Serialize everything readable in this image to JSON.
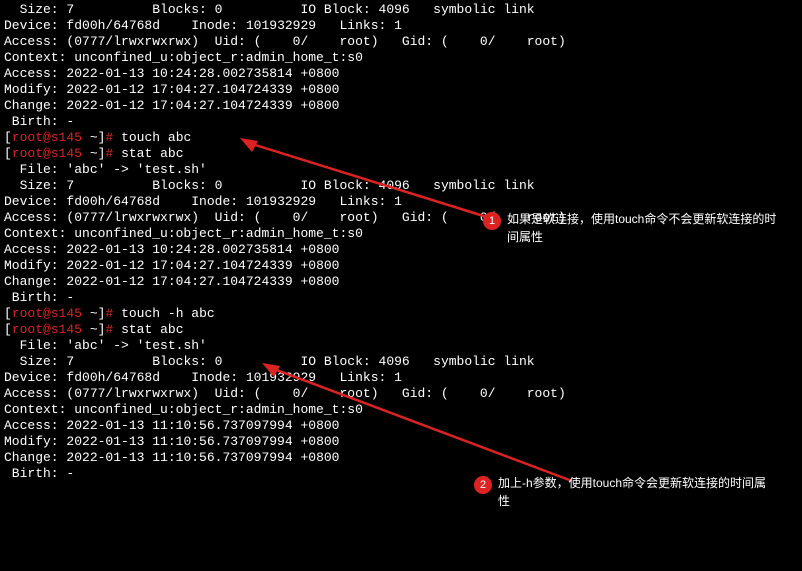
{
  "stat1": {
    "size_label": "  Size: ",
    "size_val": "7",
    "blocks_label": "          Blocks: ",
    "blocks_val": "0",
    "ioblock_label": "          IO Block: ",
    "ioblock_val": "4096",
    "type": "   symbolic link",
    "device_label": "Device: ",
    "device_val": "fd00h/64768d",
    "inode_label": "    Inode: ",
    "inode_val": "101932929",
    "links_label": "   Links: ",
    "links_val": "1",
    "access_label": "Access: ",
    "access_perm": "(0777/lrwxrwxrwx)",
    "uid_label": "  Uid: (",
    "uid_val": "    0/",
    "uid_name": "    root)",
    "gid_label": "   Gid: (",
    "gid_val": "    0/",
    "gid_name": "    root)",
    "context_label": "Context: ",
    "context_val": "unconfined_u:object_r:admin_home_t:s0",
    "atime_label": "Access: ",
    "atime_val": "2022-01-13 10:24:28.002735814 +0800",
    "mtime_label": "Modify: ",
    "mtime_val": "2022-01-12 17:04:27.104724339 +0800",
    "ctime_label": "Change: ",
    "ctime_val": "2022-01-12 17:04:27.104724339 +0800",
    "birth_label": " Birth: ",
    "birth_val": "-"
  },
  "prompt1": {
    "user": "root@s145",
    "tilde": "~",
    "cmd": " touch abc"
  },
  "prompt2": {
    "user": "root@s145",
    "tilde": "~",
    "cmd": " stat abc"
  },
  "stat2": {
    "file_label": "  File: ",
    "file_val": "'abc' -> 'test.sh'",
    "size_label": "  Size: ",
    "size_val": "7",
    "blocks_label": "          Blocks: ",
    "blocks_val": "0",
    "ioblock_label": "          IO Block: ",
    "ioblock_val": "4096",
    "type": "   symbolic link",
    "device_label": "Device: ",
    "device_val": "fd00h/64768d",
    "inode_label": "    Inode: ",
    "inode_val": "101932929",
    "links_label": "   Links: ",
    "links_val": "1",
    "access_label": "Access: ",
    "access_perm": "(0777/lrwxrwxrwx)",
    "uid_label": "  Uid: (",
    "uid_val": "    0/",
    "uid_name": "    root)",
    "gid_label": "   Gid: (",
    "gid_val": "    0/",
    "gid_name": "    root)",
    "context_label": "Context: ",
    "context_val": "unconfined_u:object_r:admin_home_t:s0",
    "atime_label": "Access: ",
    "atime_val": "2022-01-13 10:24:28.002735814 +0800",
    "mtime_label": "Modify: ",
    "mtime_val": "2022-01-12 17:04:27.104724339 +0800",
    "ctime_label": "Change: ",
    "ctime_val": "2022-01-12 17:04:27.104724339 +0800",
    "birth_label": " Birth: ",
    "birth_val": "-"
  },
  "prompt3": {
    "user": "root@s145",
    "tilde": "~",
    "cmd": " touch -h abc"
  },
  "prompt4": {
    "user": "root@s145",
    "tilde": "~",
    "cmd": " stat abc"
  },
  "stat3": {
    "file_label": "  File: ",
    "file_val": "'abc' -> 'test.sh'",
    "size_label": "  Size: ",
    "size_val": "7",
    "blocks_label": "          Blocks: ",
    "blocks_val": "0",
    "ioblock_label": "          IO Block: ",
    "ioblock_val": "4096",
    "type": "   symbolic link",
    "device_label": "Device: ",
    "device_val": "fd00h/64768d",
    "inode_label": "    Inode: ",
    "inode_val": "101932929",
    "links_label": "   Links: ",
    "links_val": "1",
    "access_label": "Access: ",
    "access_perm": "(0777/lrwxrwxrwx)",
    "uid_label": "  Uid: (",
    "uid_val": "    0/",
    "uid_name": "    root)",
    "gid_label": "   Gid: (",
    "gid_val": "    0/",
    "gid_name": "    root)",
    "context_label": "Context: ",
    "context_val": "unconfined_u:object_r:admin_home_t:s0",
    "atime_label": "Access: ",
    "atime_val": "2022-01-13 11:10:56.737097994 +0800",
    "mtime_label": "Modify: ",
    "mtime_val": "2022-01-13 11:10:56.737097994 +0800",
    "ctime_label": "Change: ",
    "ctime_val": "2022-01-13 11:10:56.737097994 +0800",
    "birth_label": " Birth: ",
    "birth_val": "-"
  },
  "annotations": {
    "a1": {
      "num": "1",
      "text": "如果是软连接，使用touch命令不会更新软连接的时间属性"
    },
    "a2": {
      "num": "2",
      "text": "加上-h参数，使用touch命令会更新软连接的时间属性"
    }
  }
}
